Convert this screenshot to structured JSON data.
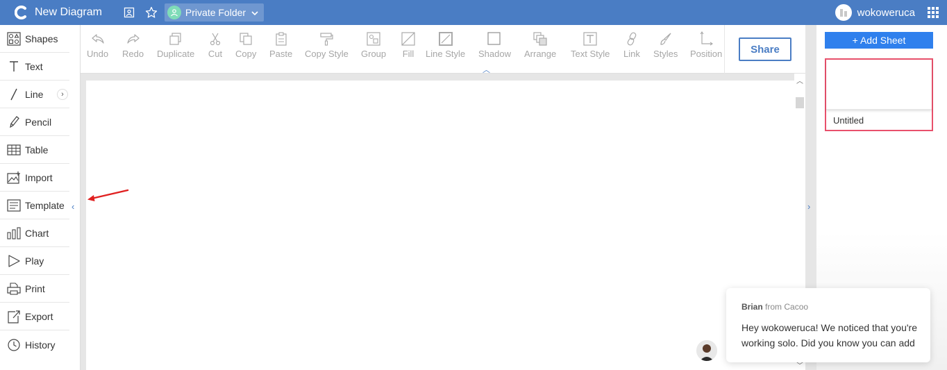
{
  "header": {
    "title": "New Diagram",
    "folder_label": "Private Folder",
    "username": "wokoweruca"
  },
  "sidebar": {
    "items": [
      {
        "label": "Shapes",
        "icon": "shapes-icon"
      },
      {
        "label": "Text",
        "icon": "text-icon"
      },
      {
        "label": "Line",
        "icon": "line-icon"
      },
      {
        "label": "Pencil",
        "icon": "pencil-icon"
      },
      {
        "label": "Table",
        "icon": "table-icon"
      },
      {
        "label": "Import",
        "icon": "image-import-icon"
      },
      {
        "label": "Template",
        "icon": "template-icon"
      },
      {
        "label": "Chart",
        "icon": "bar-chart-icon"
      },
      {
        "label": "Play",
        "icon": "play-icon"
      },
      {
        "label": "Print",
        "icon": "print-icon"
      },
      {
        "label": "Export",
        "icon": "export-icon"
      },
      {
        "label": "History",
        "icon": "history-icon"
      }
    ]
  },
  "toolbar": {
    "tools": [
      {
        "label": "Undo",
        "icon": "undo-icon"
      },
      {
        "label": "Redo",
        "icon": "redo-icon"
      },
      {
        "label": "Duplicate",
        "icon": "duplicate-icon"
      },
      {
        "label": "Cut",
        "icon": "scissors-icon"
      },
      {
        "label": "Copy",
        "icon": "copy-icon"
      },
      {
        "label": "Paste",
        "icon": "clipboard-icon"
      },
      {
        "label": "Copy Style",
        "icon": "paint-roller-icon"
      },
      {
        "label": "Group",
        "icon": "group-icon"
      },
      {
        "label": "Fill",
        "icon": "fill-icon"
      },
      {
        "label": "Line Style",
        "icon": "line-style-icon"
      },
      {
        "label": "Shadow",
        "icon": "shadow-icon"
      },
      {
        "label": "Arrange",
        "icon": "arrange-icon"
      },
      {
        "label": "Text Style",
        "icon": "text-style-icon"
      },
      {
        "label": "Link",
        "icon": "link-icon"
      },
      {
        "label": "Styles",
        "icon": "brush-icon"
      },
      {
        "label": "Position",
        "icon": "position-icon"
      }
    ],
    "share_label": "Share"
  },
  "sheets": {
    "add_label": "+ Add Sheet",
    "items": [
      {
        "name": "Untitled"
      }
    ]
  },
  "chat": {
    "sender": "Brian",
    "from_text": "from Cacoo",
    "message": "Hey wokoweruca! We noticed that you're working solo. Did you know you can add"
  },
  "colors": {
    "topbar": "#4a7dc4",
    "accent": "#2f80ed",
    "selected_sheet_border": "#e8506b",
    "annotation_arrow": "#e02020"
  }
}
